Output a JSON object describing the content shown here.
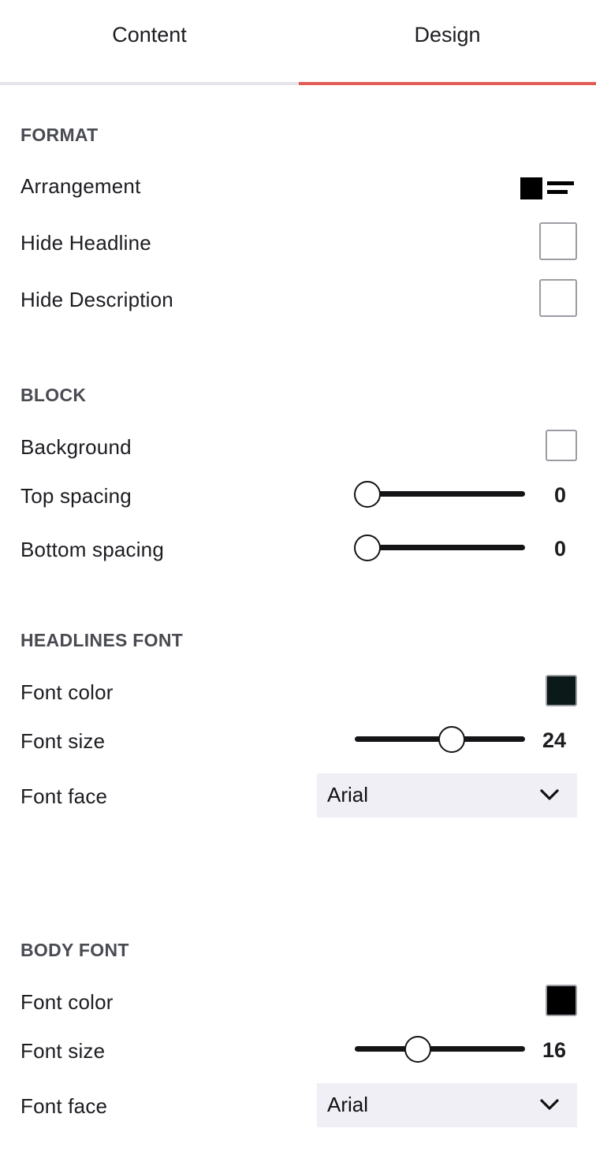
{
  "tabs": {
    "content": "Content",
    "design": "Design",
    "active": "design",
    "active_color": "#e25b57"
  },
  "format": {
    "title": "FORMAT",
    "arrangement_label": "Arrangement",
    "arrangement_icon": "image-left-text-icon",
    "hide_headline_label": "Hide Headline",
    "hide_headline_checked": false,
    "hide_description_label": "Hide Description",
    "hide_description_checked": false
  },
  "block": {
    "title": "BLOCK",
    "background_label": "Background",
    "background_checked": false,
    "top_spacing_label": "Top spacing",
    "top_spacing_value": "0",
    "top_spacing_fraction": 0,
    "bottom_spacing_label": "Bottom spacing",
    "bottom_spacing_value": "0",
    "bottom_spacing_fraction": 0
  },
  "headlines_font": {
    "title": "HEADLINES FONT",
    "color_label": "Font color",
    "color_value": "#0b1a18",
    "size_label": "Font size",
    "size_value": "24",
    "size_fraction": 0.58,
    "face_label": "Font face",
    "face_value": "Arial"
  },
  "body_font": {
    "title": "BODY FONT",
    "color_label": "Font color",
    "color_value": "#000000",
    "size_label": "Font size",
    "size_value": "16",
    "size_fraction": 0.35,
    "face_label": "Font face",
    "face_value": "Arial"
  }
}
